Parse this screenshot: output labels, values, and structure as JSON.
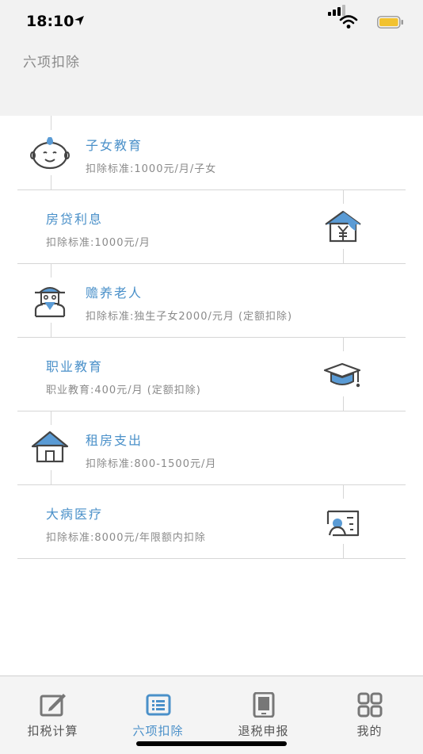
{
  "status": {
    "time": "18:10"
  },
  "header": {
    "title": "六项扣除"
  },
  "items": [
    {
      "title": "子女教育",
      "desc": "扣除标准:1000元/月/子女",
      "icon": "child-face-icon"
    },
    {
      "title": "房贷利息",
      "desc": "扣除标准:1000元/月",
      "icon": "house-yuan-icon"
    },
    {
      "title": "赡养老人",
      "desc": "扣除标准:独生子女2000/元月 (定额扣除)",
      "icon": "elder-icon"
    },
    {
      "title": "职业教育",
      "desc": "职业教育:400元/月 (定额扣除)",
      "icon": "graduation-cap-icon"
    },
    {
      "title": "租房支出",
      "desc": "扣除标准:800-1500元/月",
      "icon": "house-icon"
    },
    {
      "title": "大病医疗",
      "desc": "扣除标准:8000元/年限额内扣除",
      "icon": "medical-card-icon"
    }
  ],
  "tabs": [
    {
      "label": "扣税计算",
      "icon": "edit-icon"
    },
    {
      "label": "六项扣除",
      "icon": "list-icon",
      "active": true
    },
    {
      "label": "退税申报",
      "icon": "tablet-icon"
    },
    {
      "label": "我的",
      "icon": "grid-icon"
    }
  ],
  "colors": {
    "accent": "#4a90c9",
    "icon_blue": "#5a9bd5",
    "text_gray": "#8a8a8a",
    "header_bg": "#f2f2f2"
  }
}
